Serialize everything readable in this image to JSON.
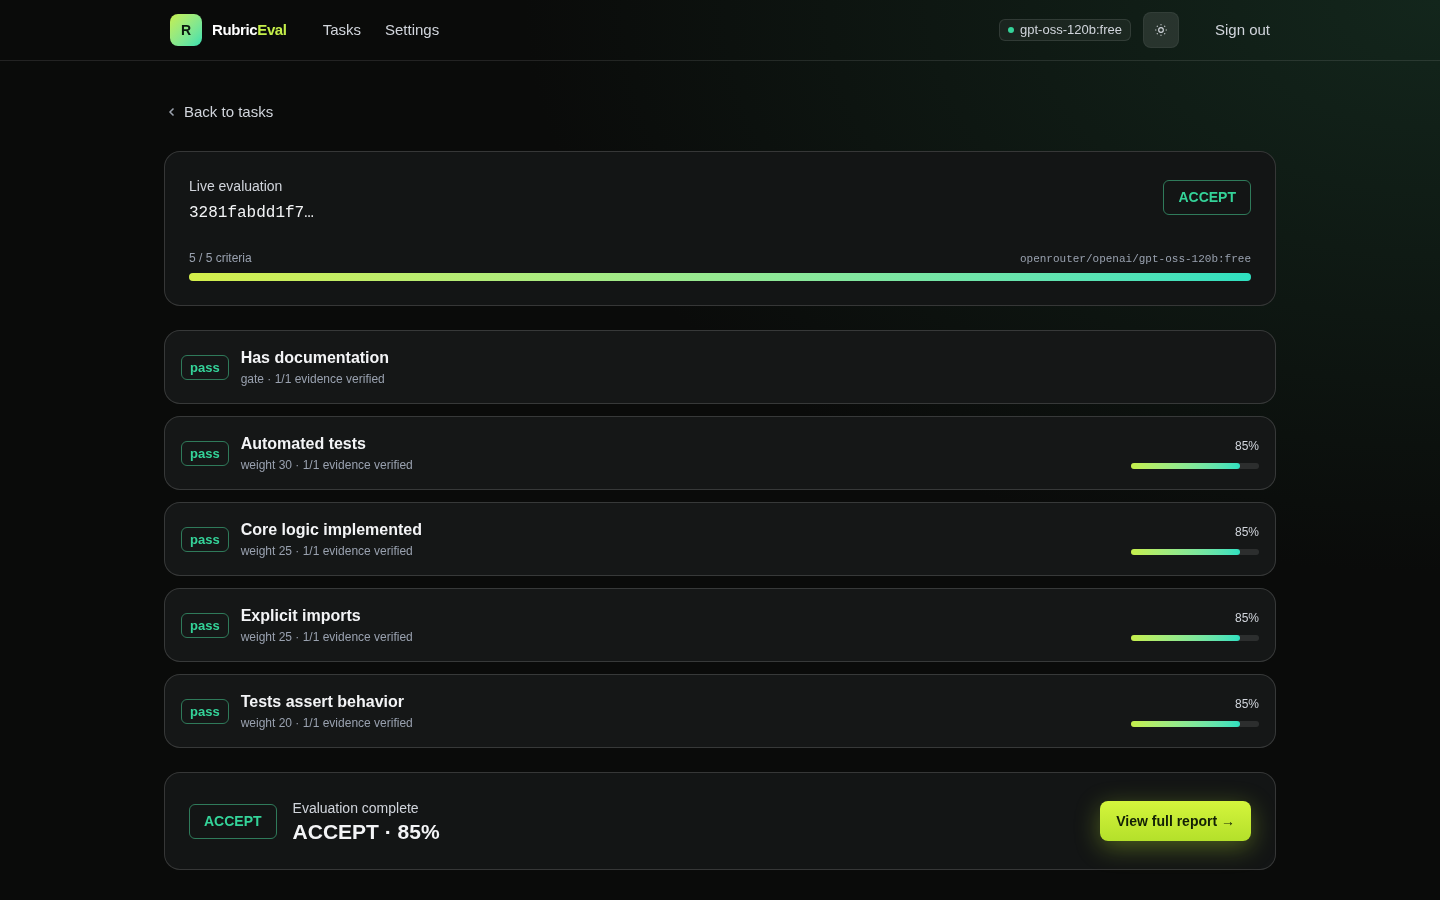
{
  "nav": {
    "logo_mark": "R",
    "brand_a": "Rubric",
    "brand_b": "Eval",
    "links": [
      "Tasks",
      "Settings"
    ],
    "model_badge": "gpt-oss-120b:free",
    "sign_out": "Sign out"
  },
  "back_link": "Back to tasks",
  "live": {
    "label": "Live evaluation",
    "id": "3281fabdd1f7…",
    "verdict": "ACCEPT",
    "progress_text": "5 / 5 criteria",
    "model_path": "openrouter/openai/gpt-oss-120b:free",
    "level": 1
  },
  "criteria": [
    {
      "kind": "gate",
      "status": "pass",
      "title": "Has documentation",
      "meta": "gate · 1/1 evidence verified"
    },
    {
      "kind": "weighted",
      "status": "pass",
      "title": "Automated tests",
      "meta": "weight 30 · 1/1 evidence verified",
      "score": "85%",
      "level": 0.85
    },
    {
      "kind": "weighted",
      "status": "pass",
      "title": "Core logic implemented",
      "meta": "weight 25 · 1/1 evidence verified",
      "score": "85%",
      "level": 0.85
    },
    {
      "kind": "weighted",
      "status": "pass",
      "title": "Explicit imports",
      "meta": "weight 25 · 1/1 evidence verified",
      "score": "85%",
      "level": 0.85
    },
    {
      "kind": "weighted",
      "status": "pass",
      "title": "Tests assert behavior",
      "meta": "weight 20 · 1/1 evidence verified",
      "score": "85%",
      "level": 0.85
    }
  ],
  "summary": {
    "verdict": "ACCEPT",
    "label": "Evaluation complete",
    "result": "ACCEPT · 85%",
    "button": "View full report →"
  }
}
